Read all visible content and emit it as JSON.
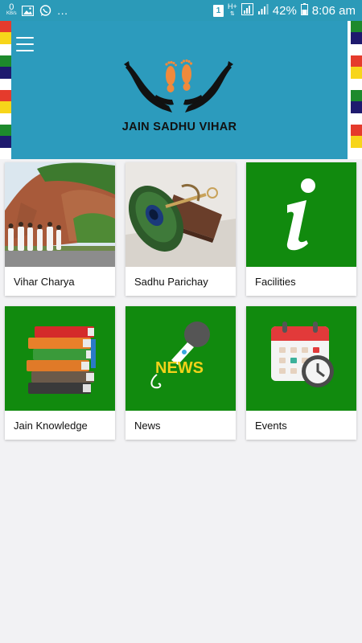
{
  "status_bar": {
    "speed_value": "0",
    "speed_unit": "KB/s",
    "sim": "1",
    "network_type": "H+",
    "battery": "42%",
    "time": "8:06 am",
    "icons": [
      "image-icon",
      "whatsapp-icon",
      "more-notifications-icon",
      "sim-icon",
      "signal-icon",
      "battery-icon"
    ]
  },
  "header": {
    "title": "JAIN SADHU VIHAR",
    "menu_icon": "hamburger-menu-icon",
    "logo": "hands-holding-footprints-logo",
    "colors": {
      "background": "#2c9bbd",
      "footprints": "#f08a3c",
      "hands": "#111111"
    }
  },
  "stripe_colors": [
    "#e53b2c",
    "#f7d51a",
    "#ffffff",
    "#1d8a2c",
    "#1e1a6e",
    "#ffffff",
    "#e53b2c",
    "#f7d51a",
    "#ffffff",
    "#1d8a2c",
    "#1e1a6e",
    "#ffffff"
  ],
  "tiles": [
    {
      "label": "Vihar Charya",
      "icon": "monks-walking-photo"
    },
    {
      "label": "Sadhu Parichay",
      "icon": "peacock-feather-broom-photo"
    },
    {
      "label": "Facilities",
      "icon": "info-icon"
    },
    {
      "label": "Jain Knowledge",
      "icon": "books-stack-icon"
    },
    {
      "label": "News",
      "icon": "news-microphone-icon"
    },
    {
      "label": "Events",
      "icon": "calendar-clock-icon"
    }
  ],
  "colors": {
    "tile_green": "#118a0e",
    "page_background": "#f2f2f4"
  }
}
